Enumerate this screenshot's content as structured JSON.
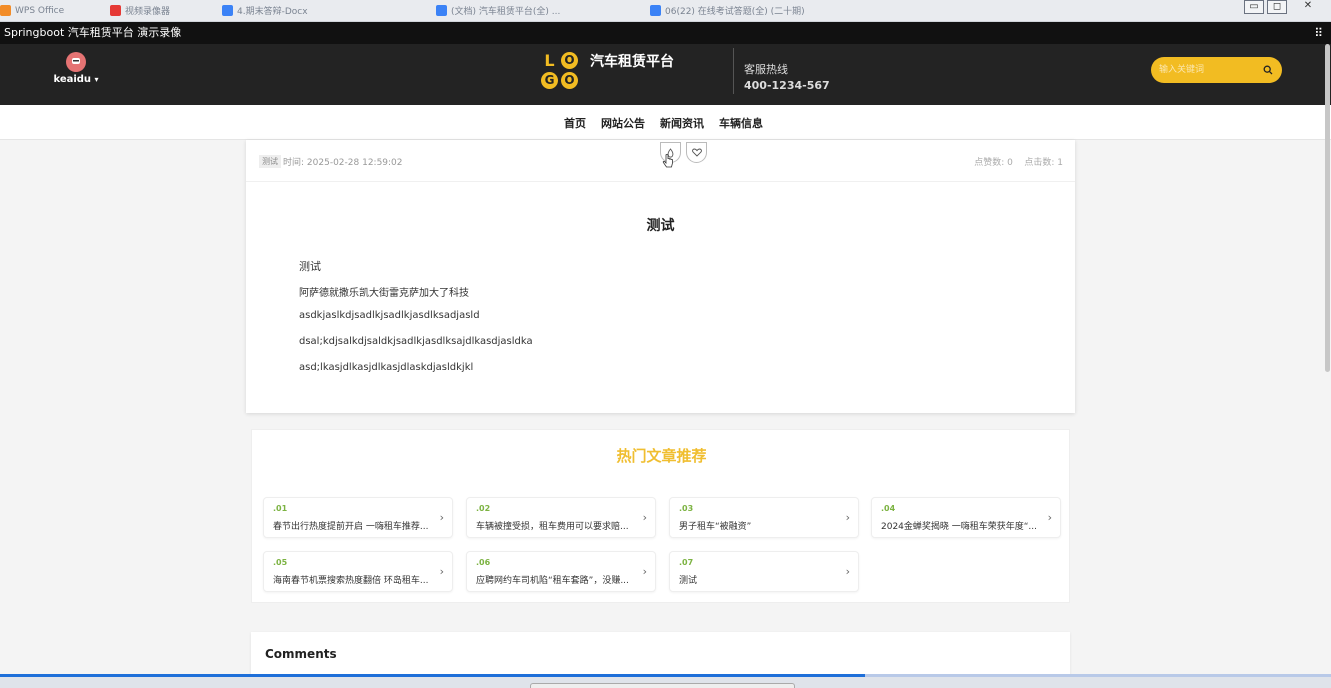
{
  "os_strip": {
    "tabs": [
      "WPS Office",
      "视频录像器",
      "4.期末答辩-Docx",
      "(文档) 汽车租赁平台(全) ...",
      "06(22) 在线考试答题(全) (二十期)"
    ],
    "controls": [
      "▭",
      "◻",
      "✕"
    ]
  },
  "recorder": {
    "title": "Springboot 汽车租赁平台 演示录像",
    "corner_icon": "drag-handle-icon"
  },
  "header": {
    "username": "keaidu",
    "logo_letters": [
      "L",
      "O",
      "G",
      "O"
    ],
    "brand": "汽车租赁平台",
    "hotline_label": "客服热线",
    "hotline_number": "400-1234-567",
    "search_placeholder": "输入关键词",
    "colors": {
      "background": "#232323",
      "accent": "#f2bc22"
    }
  },
  "nav": {
    "items": [
      "首页",
      "网站公告",
      "新闻资讯",
      "车辆信息"
    ]
  },
  "article": {
    "tag": "测试",
    "time_label": "时间:",
    "time_value": "2025-02-28 12:59:02",
    "likes_label": "点赞数:",
    "likes": "0",
    "clicks_label": "点击数:",
    "clicks": "1",
    "title": "测试",
    "paragraphs": [
      "测试",
      "阿萨德就撒乐凯大街雷克萨加大了科技",
      "asdkjaslkdjsadlkjsadlkjasdlksadjasld",
      "dsal;kdjsalkdjsaldkjsadlkjasdlksajdlkasdjasldka",
      "asd;lkasjdlkasjdlkasjdlaskdjasldkjkl"
    ]
  },
  "hot": {
    "title": "热门文章推荐",
    "items": [
      {
        "num": ".01",
        "text": "春节出行热度提前开启 一嗨租车推荐..."
      },
      {
        "num": ".02",
        "text": "车辆被撞受损，租车费用可以要求赔..."
      },
      {
        "num": ".03",
        "text": "男子租车“被融资”"
      },
      {
        "num": ".04",
        "text": "2024金蝉奖揭晓 一嗨租车荣获年度“..."
      },
      {
        "num": ".05",
        "text": "海南春节机票搜索热度翻倍 环岛租车..."
      },
      {
        "num": ".06",
        "text": "应聘网约车司机陷“租车套路”，没赚..."
      },
      {
        "num": ".07",
        "text": "测试"
      }
    ],
    "arrow": "›"
  },
  "comments": {
    "title": "Comments"
  },
  "player": {
    "progress": 0.65
  }
}
